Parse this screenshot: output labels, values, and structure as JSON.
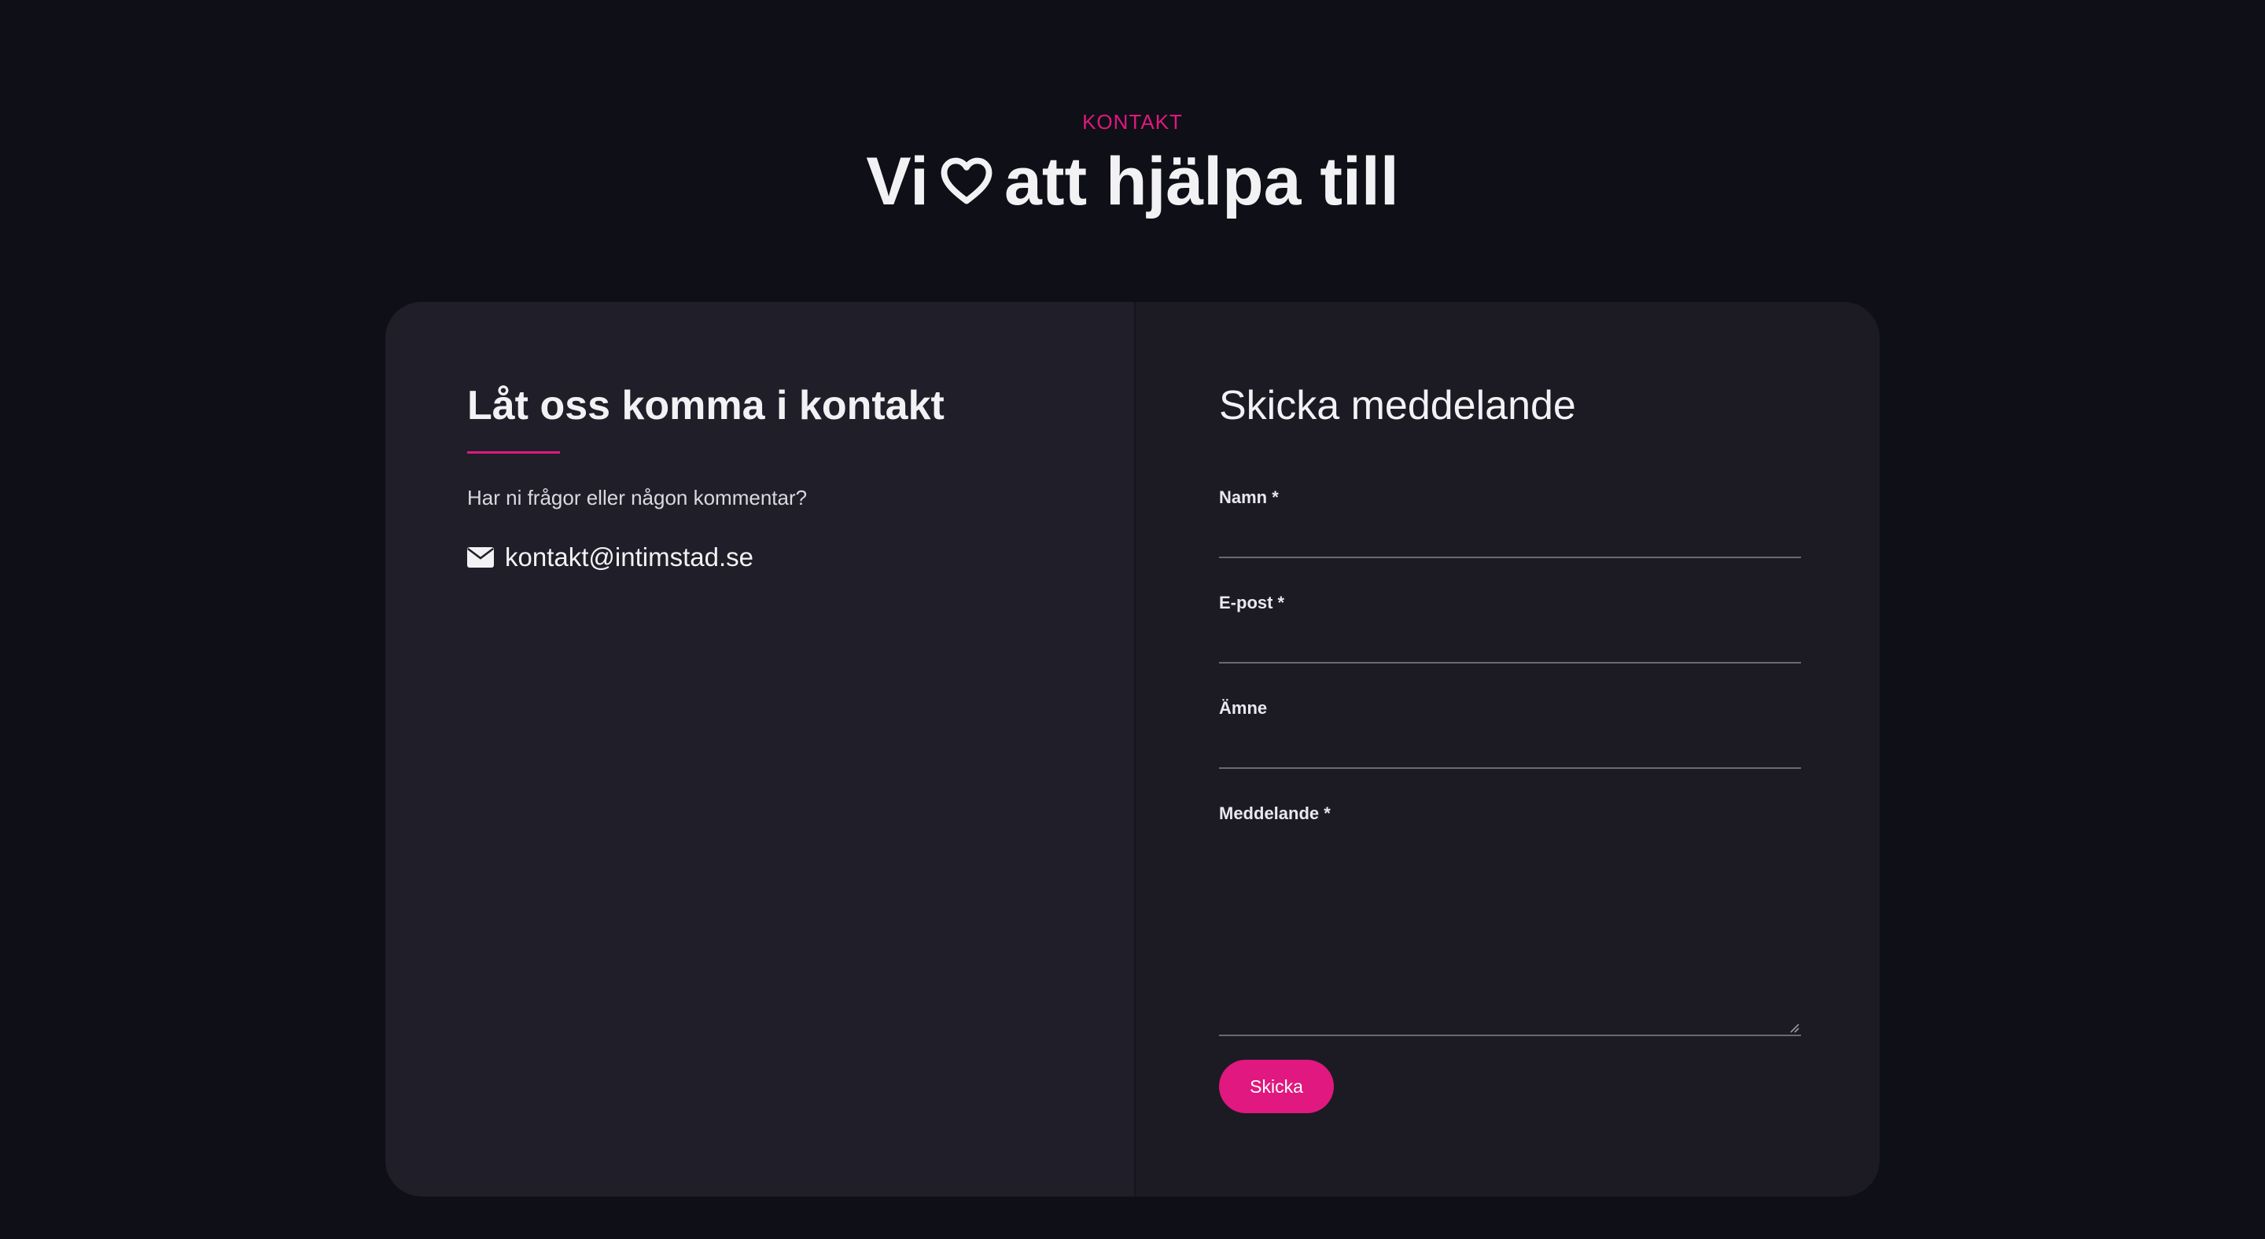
{
  "header": {
    "eyebrow": "KONTAKT",
    "title_before": "Vi",
    "title_icon": "heart-outline-icon",
    "title_after": "att hjälpa till"
  },
  "left": {
    "title": "Låt oss komma i kontakt",
    "subtitle": "Har ni frågor eller någon kommentar?",
    "email_icon": "envelope-icon",
    "email": "kontakt@intimstad.se"
  },
  "form": {
    "title": "Skicka meddelande",
    "fields": {
      "name": {
        "label": "Namn *",
        "value": ""
      },
      "email": {
        "label": "E-post *",
        "value": ""
      },
      "subject": {
        "label": "Ämne",
        "value": ""
      },
      "message": {
        "label": "Meddelande *",
        "value": ""
      }
    },
    "submit_label": "Skicka"
  },
  "colors": {
    "background": "#0f0f17",
    "card_left": "#201f29",
    "card_right": "#1c1b24",
    "accent": "#e0187f",
    "text": "#f2f2f5"
  }
}
